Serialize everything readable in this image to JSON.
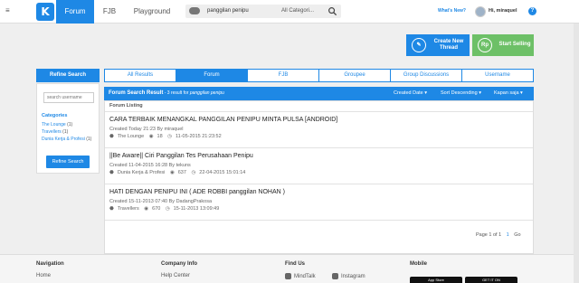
{
  "topbar": {
    "nav": {
      "forum": "Forum",
      "fjb": "FJB",
      "playground": "Playground"
    },
    "search": {
      "value": "panggilan penipu",
      "category": "All Categori...",
      "placeholder": ""
    },
    "whats_new": "What's New?",
    "greeting": "Hi, miraquel"
  },
  "actions": {
    "create_thread_line1": "Create New",
    "create_thread_line2": "Thread",
    "start_selling": "Start Selling",
    "create_icon": "pencil-icon",
    "sell_icon": "rupiah-icon"
  },
  "sidebar": {
    "refine_title": "Refine Search",
    "search_placeholder": "search username",
    "categories_title": "Categories",
    "categories": [
      {
        "name": "The Lounge",
        "count": "(1)"
      },
      {
        "name": "Travellers",
        "count": "(1)"
      },
      {
        "name": "Dunia Kerja & Profesi",
        "count": "(1)"
      }
    ],
    "refine_button": "Refine Search"
  },
  "tabs": [
    "All Results",
    "Forum",
    "FJB",
    "Groupee",
    "Group Discussions",
    "Username"
  ],
  "active_tab": "Forum",
  "results": {
    "title": "Forum Search Result",
    "subtitle_prefix": " - 3 result for ",
    "subtitle_query": "panggilan penipu",
    "sort_date": "Created Date",
    "sort_order": "Sort Descending",
    "filter": "Kapan saja",
    "listing_label": "Forum Listing",
    "threads": [
      {
        "title": "CARA TERBAIK MENANGKAL PANGGILAN PENIPU MINTA PULSA [ANDROID]",
        "created": "Created Today 21:23 By miraquel",
        "category": "The Lounge",
        "views": "18",
        "last": "11-05-2015 21:23:52"
      },
      {
        "title": "||Be Aware|| Ciri Panggilan Tes Perusahaan Penipu",
        "created": "Created 11-04-2015 16:28 By tekuns",
        "category": "Dunia Kerja & Profesi",
        "views": "637",
        "last": "22-04-2015 15:01:14"
      },
      {
        "title": "HATI DENGAN PENIPU INI ( ADE ROBBI panggilan NOHAN )",
        "created": "Created 15-11-2013 07:40 By DadangPrakosa",
        "category": "Travellers",
        "views": "670",
        "last": "15-11-2013 13:09:49"
      }
    ],
    "pager": {
      "label": "Page 1 of 1",
      "current": "1",
      "go": "Go"
    }
  },
  "footer": {
    "navigation": {
      "title": "Navigation",
      "link": "Home"
    },
    "company": {
      "title": "Company Info",
      "link": "Help Center"
    },
    "find_us": {
      "title": "Find Us",
      "link1": "MindTalk",
      "link2": "Instagram"
    },
    "mobile": {
      "title": "Mobile",
      "store1": "App Store",
      "store2": "GET IT ON"
    }
  },
  "colors": {
    "accent": "#1e88e5",
    "sell": "#6dc067"
  }
}
